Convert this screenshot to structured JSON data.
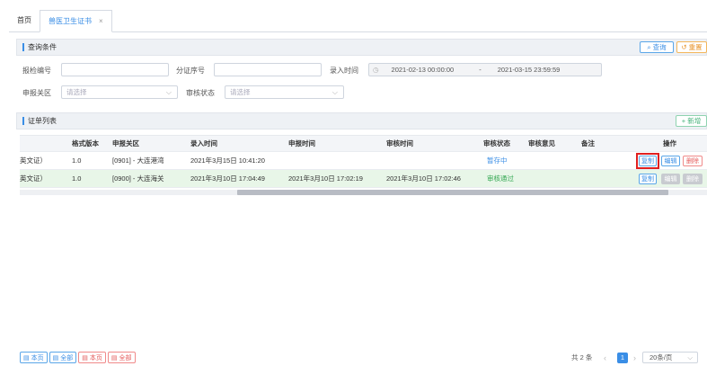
{
  "tabs": [
    {
      "label": "首页"
    },
    {
      "label": "兽医卫生证书",
      "close": "×"
    }
  ],
  "query": {
    "title": "查询条件",
    "search_btn": "查询",
    "reset_btn": "重置",
    "fields": {
      "report_no_label": "报检编号",
      "cert_no_label": "分证序号",
      "entry_time_label": "录入时间",
      "date_start": "2021-02-13 00:00:00",
      "date_sep": "-",
      "date_end": "2021-03-15 23:59:59",
      "customs_label": "申报关区",
      "customs_placeholder": "请选择",
      "status_label": "审核状态",
      "status_placeholder": "请选择"
    }
  },
  "list": {
    "title": "证单列表",
    "add_btn": "+ 新增",
    "columns": [
      "格式版本",
      "申报关区",
      "录入时间",
      "申报时间",
      "审核时间",
      "审核状态",
      "审核意见",
      "备注",
      "操作"
    ],
    "rows": [
      {
        "type": "英文证）",
        "version": "1.0",
        "customs": "[0901] - 大连港湾",
        "entry": "2021年3月15日 10:41:20",
        "declare": "",
        "audit": "",
        "status": "暂存中",
        "opinion": "",
        "remark": "",
        "ops": [
          "复制",
          "编辑",
          "删除"
        ]
      },
      {
        "type": "英文证）",
        "version": "1.0",
        "customs": "[0900] - 大连海关",
        "entry": "2021年3月10日 17:04:49",
        "declare": "2021年3月10日 17:02:19",
        "audit": "2021年3月10日 17:02:46",
        "status": "审核通过",
        "opinion": "",
        "remark": "",
        "ops": [
          "复制",
          "编辑",
          "删除"
        ]
      }
    ]
  },
  "footer": {
    "export_buttons": [
      "本页",
      "全部",
      "本页",
      "全部"
    ],
    "total": "共 2 条",
    "prev": "‹",
    "current_page": "1",
    "next": "›",
    "page_size": "20条/页"
  },
  "colors": {
    "accent": "#3a8ee6",
    "success": "#35a853",
    "danger": "#e45a5a",
    "warning": "#e8952d"
  }
}
